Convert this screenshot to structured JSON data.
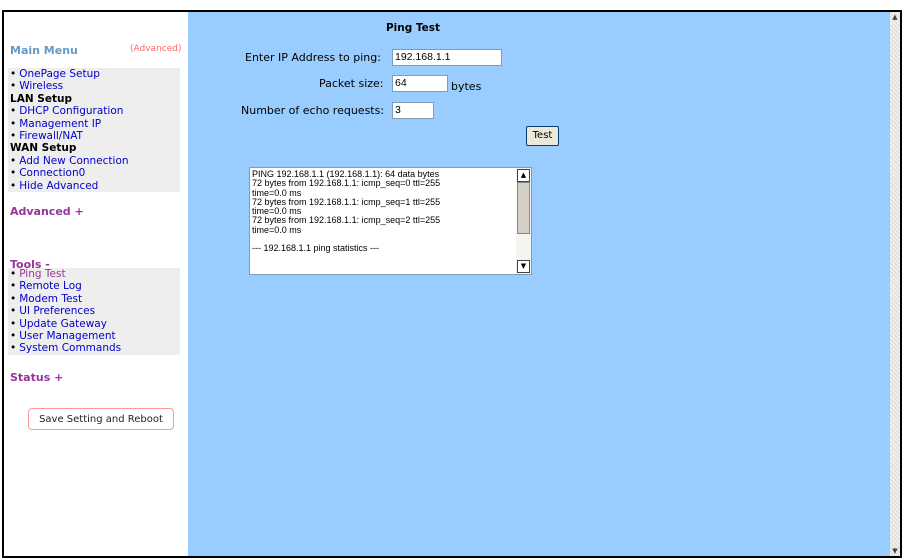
{
  "sidebar": {
    "main_menu_title": "Main Menu",
    "advanced_link": "(Advanced)",
    "main_items": [
      {
        "type": "item",
        "label": "OnePage Setup"
      },
      {
        "type": "item",
        "label": "Wireless"
      },
      {
        "type": "header",
        "label": "LAN Setup"
      },
      {
        "type": "item",
        "label": "DHCP Configuration"
      },
      {
        "type": "item",
        "label": "Management IP"
      },
      {
        "type": "item",
        "label": "Firewall/NAT"
      },
      {
        "type": "header",
        "label": "WAN Setup"
      },
      {
        "type": "item",
        "label": "Add New Connection"
      },
      {
        "type": "item",
        "label": "Connection0"
      },
      {
        "type": "item",
        "label": "Hide Advanced"
      }
    ],
    "advanced_section": "Advanced +",
    "tools_section": "Tools -",
    "tools_items": [
      {
        "label": "Ping Test",
        "active": true
      },
      {
        "label": "Remote Log"
      },
      {
        "label": "Modem Test"
      },
      {
        "label": "UI Preferences"
      },
      {
        "label": "Update Gateway"
      },
      {
        "label": "User Management"
      },
      {
        "label": "System Commands"
      }
    ],
    "status_section": "Status +",
    "save_button": "Save Setting and Reboot"
  },
  "ping": {
    "title": "Ping Test",
    "ip_label": "Enter IP Address to ping:",
    "ip_value": "192.168.1.1",
    "size_label": "Packet size:",
    "size_value": "64",
    "size_unit": "bytes",
    "count_label": "Number of echo requests:",
    "count_value": "3",
    "test_button": "Test",
    "output_lines": [
      "PING 192.168.1.1 (192.168.1.1): 64 data bytes",
      "72 bytes from 192.168.1.1: icmp_seq=0 ttl=255",
      "time=0.0 ms",
      "72 bytes from 192.168.1.1: icmp_seq=1 ttl=255",
      "time=0.0 ms",
      "72 bytes from 192.168.1.1: icmp_seq=2 ttl=255",
      "time=0.0 ms",
      "",
      "--- 192.168.1.1 ping statistics ---"
    ]
  },
  "icons": {
    "bullet": "bullet-icon",
    "scroll_up": "scroll-up-arrow-icon",
    "scroll_down": "scroll-down-arrow-icon"
  },
  "colors": {
    "content_bg": "#99ccff",
    "menu_title": "#6699cc",
    "link": "#0000cc",
    "section": "#993399",
    "advanced": "#ff6666"
  }
}
